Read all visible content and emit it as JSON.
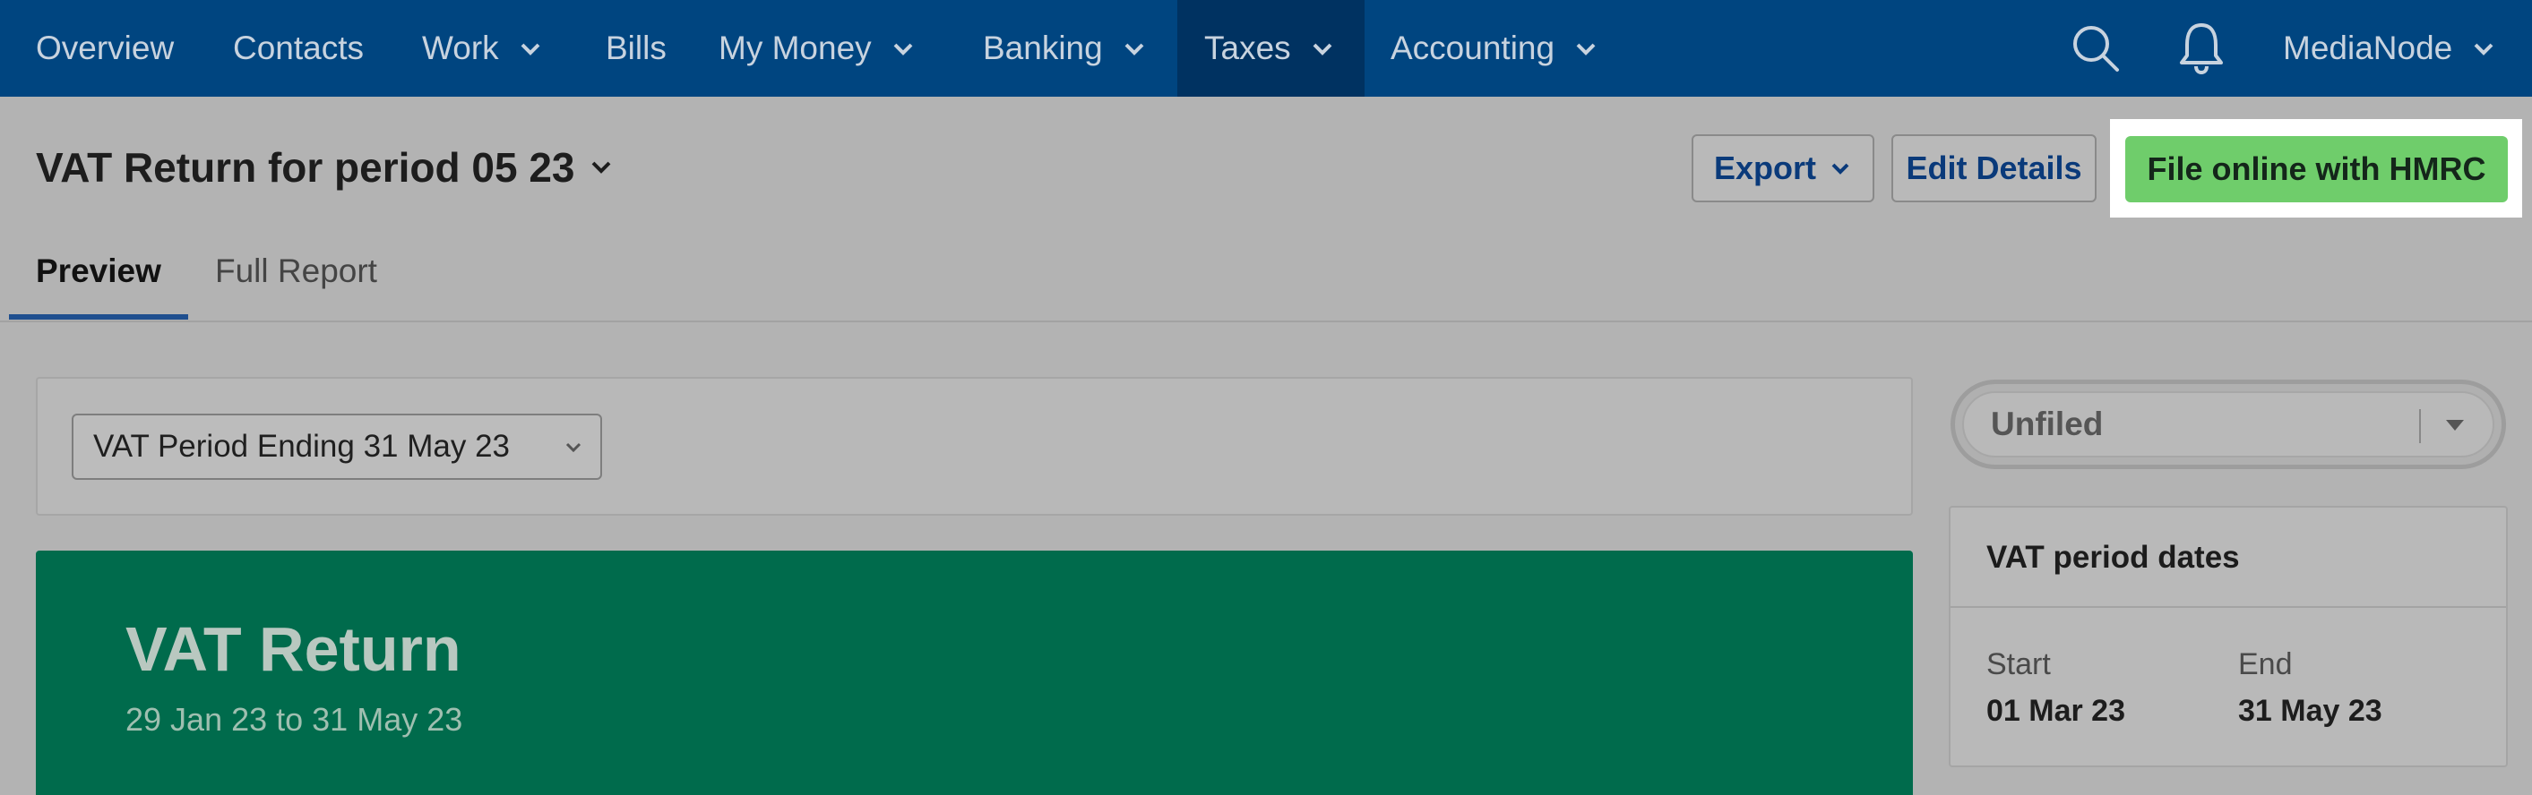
{
  "nav": {
    "items": [
      {
        "label": "Overview"
      },
      {
        "label": "Contacts"
      },
      {
        "label": "Work"
      },
      {
        "label": "Bills"
      },
      {
        "label": "My Money"
      },
      {
        "label": "Banking"
      },
      {
        "label": "Taxes"
      },
      {
        "label": "Accounting"
      }
    ],
    "active": "Taxes",
    "user_label": "MediaNode",
    "icons": [
      "search-icon",
      "bell-icon"
    ]
  },
  "header": {
    "title": "VAT Return for period 05 23",
    "export_label": "Export",
    "edit_label": "Edit Details",
    "file_label": "File online with HMRC"
  },
  "tabs": [
    {
      "label": "Preview",
      "active": true
    },
    {
      "label": "Full Report",
      "active": false
    }
  ],
  "period_select": {
    "value": "VAT Period Ending 31 May 23"
  },
  "hero": {
    "title": "VAT Return",
    "subtitle": "29 Jan 23 to 31 May 23"
  },
  "status": {
    "value": "Unfiled"
  },
  "dates_card": {
    "title": "VAT period dates",
    "start_label": "Start",
    "start_value": "01 Mar 23",
    "end_label": "End",
    "end_value": "31 May 23"
  },
  "colors": {
    "nav_bg": "#004580",
    "nav_active": "#003261",
    "hero_bg": "#006b4c",
    "file_button": "#6fcd6b"
  }
}
